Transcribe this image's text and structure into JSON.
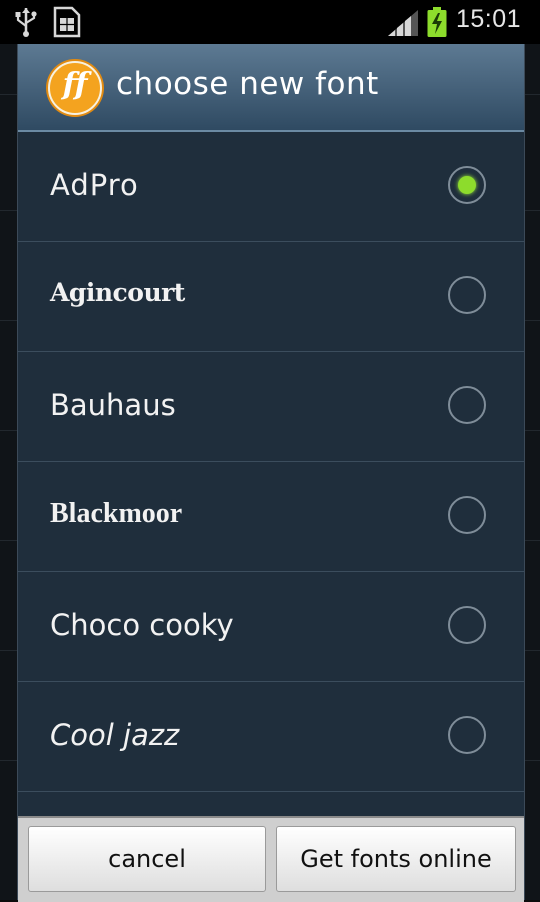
{
  "status_bar": {
    "time": "15:01",
    "icons": [
      "usb-icon",
      "sim-card-icon",
      "signal-icon",
      "battery-charging-icon"
    ]
  },
  "dialog": {
    "app_icon_letters": "ff",
    "title": "choose new font",
    "fonts": [
      {
        "label": "AdPro",
        "selected": true
      },
      {
        "label": "Agincourt",
        "selected": false
      },
      {
        "label": "Bauhaus",
        "selected": false
      },
      {
        "label": "Blackmoor",
        "selected": false
      },
      {
        "label": "Choco cooky",
        "selected": false
      },
      {
        "label": "Cool jazz",
        "selected": false
      }
    ],
    "buttons": {
      "cancel": "cancel",
      "get_fonts": "Get fonts online"
    }
  },
  "colors": {
    "selected_radio": "#8ddc2c",
    "dialog_bg": "#1f2e3c",
    "header_top": "#5d7a93",
    "logo": "#f4a31f"
  }
}
